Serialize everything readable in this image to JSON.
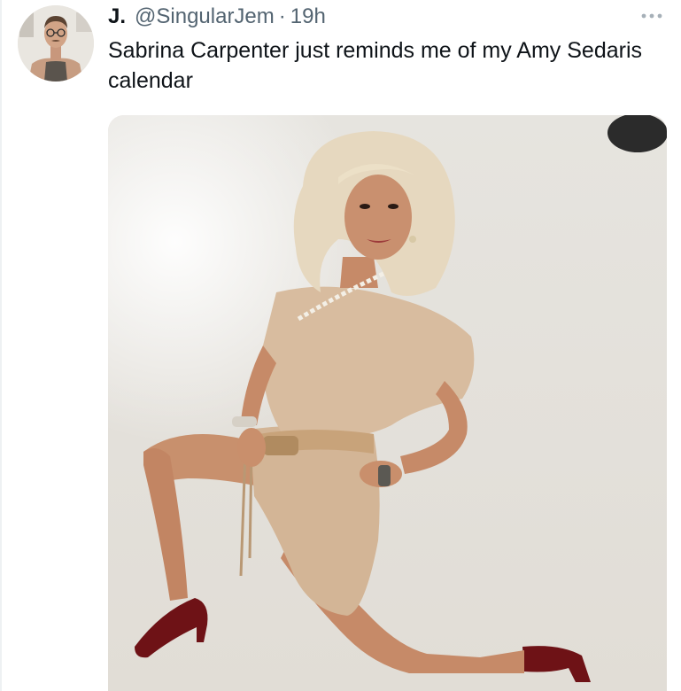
{
  "tweet": {
    "display_name": "J.",
    "handle": "@SingularJem",
    "separator": "·",
    "time": "19h",
    "text": "Sabrina Carpenter just reminds me of my Amy Sedaris calendar"
  },
  "icons": {
    "more": "more-options-icon"
  },
  "colors": {
    "text_primary": "#0f1419",
    "text_secondary": "#536471",
    "outfit": "#d8bc9f",
    "heels": "#6e1216"
  }
}
